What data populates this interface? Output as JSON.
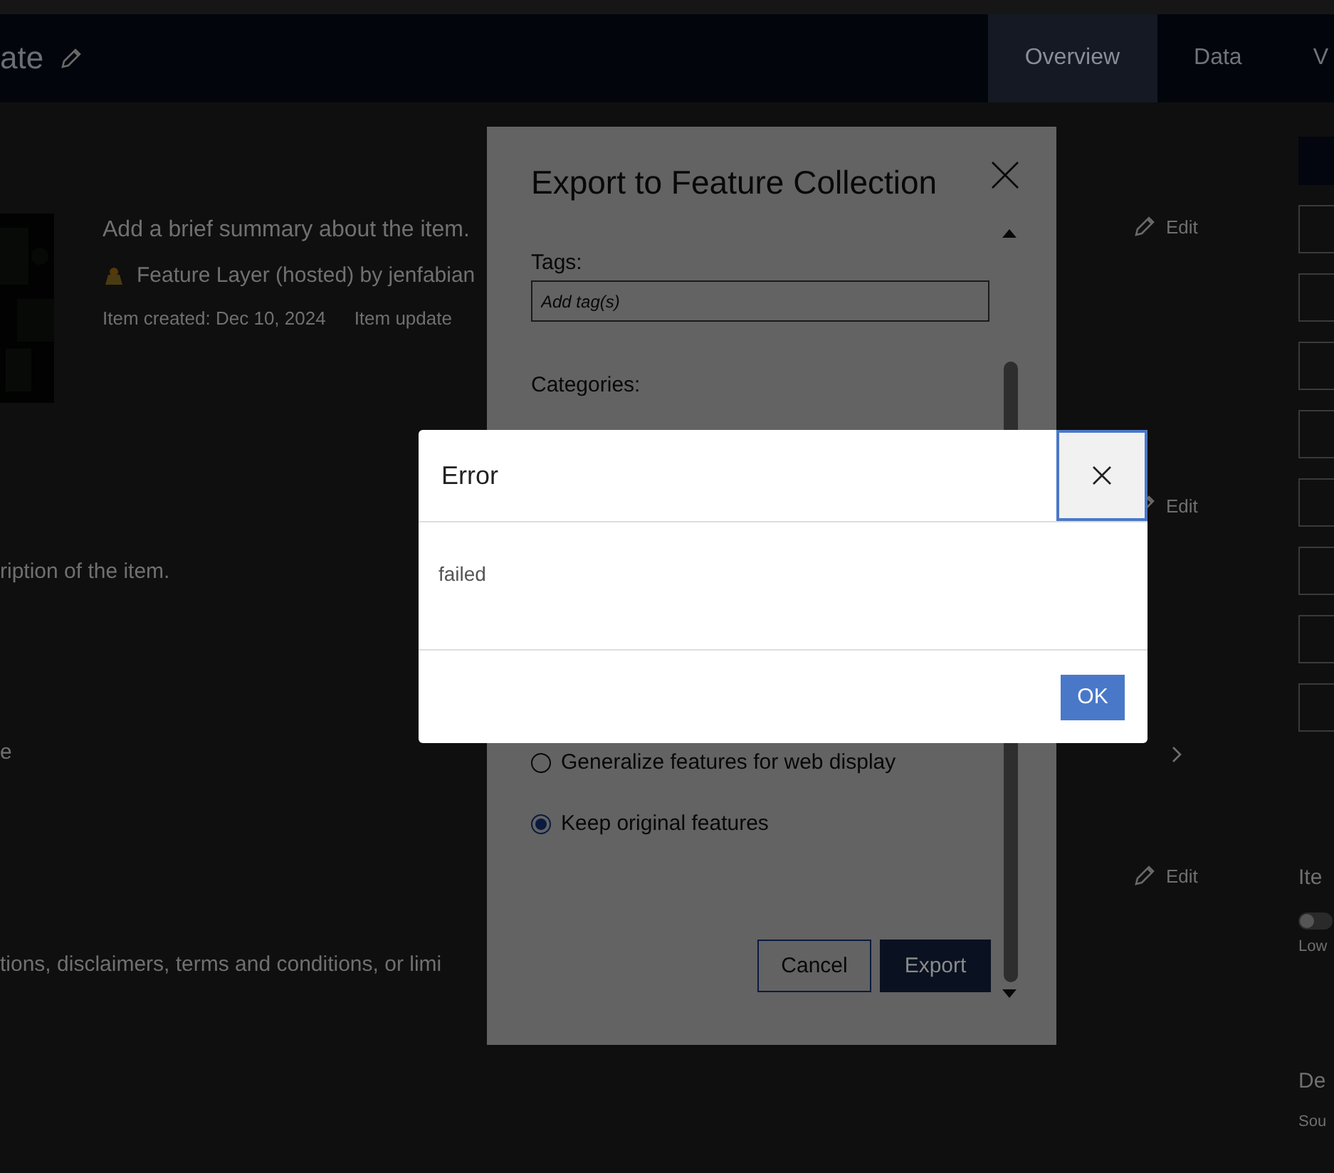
{
  "header": {
    "title": "ate",
    "tabs": [
      {
        "label": "Overview",
        "selected": true
      },
      {
        "label": "Data",
        "selected": false
      },
      {
        "label": "V",
        "selected": false
      }
    ]
  },
  "item": {
    "summary": "Add a brief summary about the item.",
    "type_line": "Feature Layer (hosted) by jenfabian",
    "created": "Item created: Dec 10, 2024",
    "updated": "Item update"
  },
  "description": "ription of the item.",
  "fragment": "e",
  "terms": "tions, disclaimers, terms and conditions, or limi",
  "edit_links": [
    "Edit",
    "Edit",
    "Edit"
  ],
  "right_panel": {
    "heading": "Ite",
    "toggle_on": false,
    "toggle_label": "Low",
    "section": "De",
    "source": "Sou"
  },
  "export_dialog": {
    "title": "Export to Feature Collection",
    "tags_label": "Tags:",
    "tags_placeholder": "Add tag(s)",
    "categories_label": "Categories:",
    "options": [
      {
        "label": "Generalize features for web display",
        "selected": false
      },
      {
        "label": "Keep original features",
        "selected": true
      }
    ],
    "buttons": [
      {
        "label": "Cancel",
        "kind": "secondary"
      },
      {
        "label": "Export",
        "kind": "primary"
      }
    ]
  },
  "error_dialog": {
    "title": "Error",
    "message": "failed",
    "button": "OK"
  }
}
